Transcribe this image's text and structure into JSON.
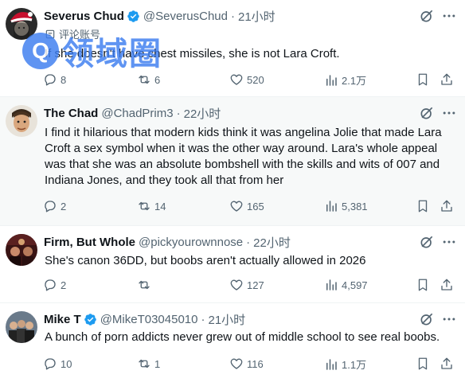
{
  "watermark": {
    "letter": "Q",
    "text": "领域圈"
  },
  "tweets": [
    {
      "name": "Severus Chud",
      "verified": true,
      "handle": "@SeverusChud",
      "time": "21小时",
      "label": "评论账号",
      "text": "If she doesn't have chest missiles, she is not Lara Croft.",
      "replies": "8",
      "reposts": "6",
      "likes": "520",
      "views": "2.1万"
    },
    {
      "name": "The Chad",
      "verified": false,
      "handle": "@ChadPrim3",
      "time": "22小时",
      "text": "I find it hilarious that modern kids think it was angelina Jolie that made Lara Croft a sex symbol when it was the other way around.  Lara's whole appeal was that she was an absolute bombshell with the skills and wits of 007 and Indiana Jones, and they took all that from her",
      "replies": "2",
      "reposts": "14",
      "likes": "165",
      "views": "5,381"
    },
    {
      "name": "Firm, But Whole",
      "verified": false,
      "handle": "@pickyourownnose",
      "time": "22小时",
      "text": "She's canon 36DD, but boobs aren't actually allowed in 2026",
      "replies": "2",
      "reposts": "",
      "likes": "127",
      "views": "4,597"
    },
    {
      "name": "Mike T",
      "verified": true,
      "handle": "@MikeT03045010",
      "time": "21小时",
      "text": "A bunch of porn addicts never grew out of middle school to see real boobs.",
      "replies": "10",
      "reposts": "1",
      "likes": "116",
      "views": "1.1万"
    }
  ],
  "icons": {
    "reply": "speech-bubble-icon",
    "repost": "repost-arrows-icon",
    "like": "heart-icon",
    "views": "bar-chart-icon",
    "bookmark": "bookmark-icon",
    "share": "share-upload-icon",
    "grok": "grok-slash-circle-icon",
    "more": "more-dots-icon"
  },
  "colors": {
    "verified": "#1d9bf0",
    "muted": "#536471",
    "text": "#0f1419",
    "watermark": "#3c7df0"
  }
}
